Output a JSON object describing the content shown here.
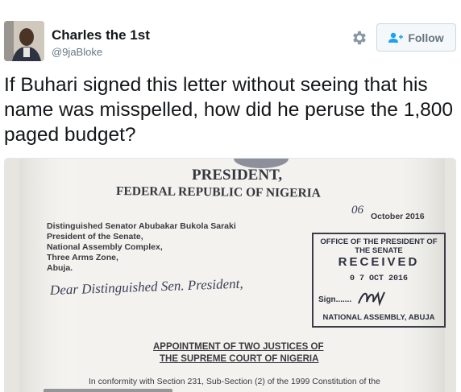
{
  "user": {
    "display_name": "Charles the 1st",
    "handle": "@9jaBloke",
    "avatar_icon": "user-avatar-photo"
  },
  "actions": {
    "settings_icon": "gear-icon",
    "follow_icon": "add-person-icon",
    "follow_label": "Follow"
  },
  "tweet": {
    "text": "If Buhari signed this letter without seeing that his name was misspelled, how did he peruse the 1,800 paged budget?"
  },
  "letter": {
    "heading": "PRESIDENT,",
    "subheading": "FEDERAL REPUBLIC OF NIGERIA",
    "date_day": "06",
    "date_rest": "October 2016",
    "address_lines": [
      "Distinguished Senator Abubakar Bukola Saraki",
      "President of the Senate,",
      "National Assembly Complex,",
      "Three Arms Zone,",
      "Abuja."
    ],
    "salutation": "Dear Distinguished Sen. President,",
    "title_line1": "APPOINTMENT OF TWO JUSTICES OF",
    "title_line2": "THE SUPREME COURT OF NIGERIA",
    "body_line": "In conformity with Section 231, Sub-Section (2) of the 1999 Constitution of the",
    "stamp": {
      "line1": "OFFICE OF THE PRESIDENT OF",
      "line2": "THE SENATE",
      "received": "RECEIVED",
      "date": "0 7  OCT  2016",
      "sign_label": "Sign.......",
      "footer": "NATIONAL ASSEMBLY, ABUJA"
    }
  },
  "colors": {
    "text_primary": "#14171a",
    "text_secondary": "#657786",
    "button_text": "#66757f",
    "button_border": "#ccd6dd",
    "paper": "#f3f2ee",
    "ink": "#3a3a40"
  }
}
